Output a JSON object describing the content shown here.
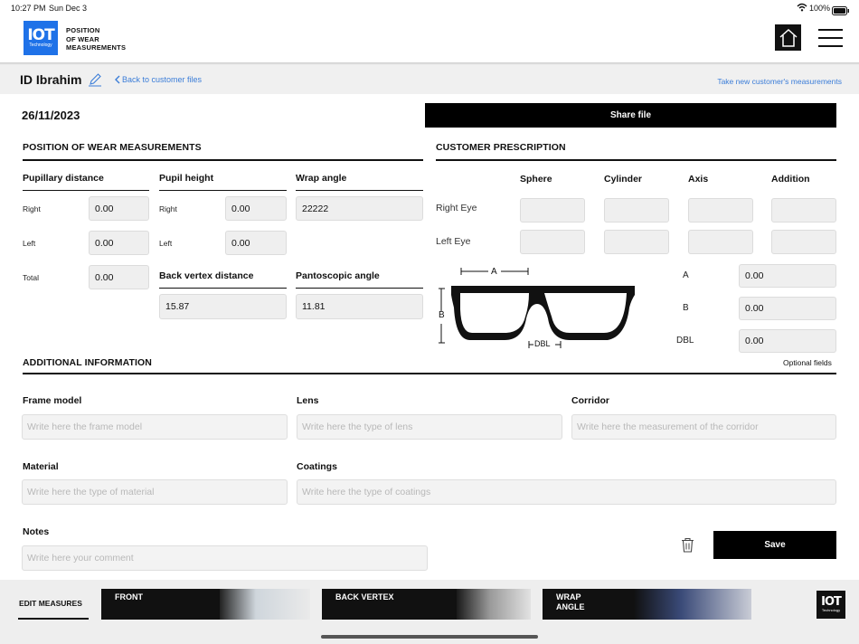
{
  "status_bar": {
    "time": "10:27 PM",
    "date": "Sun Dec 3",
    "battery": "100%"
  },
  "header": {
    "logo_text": "IOT",
    "logo_sub": "Technology",
    "title_line1": "POSITION",
    "title_line2": "OF WEAR",
    "title_line3": "MEASUREMENTS"
  },
  "subheader": {
    "customer": "ID Ibrahim",
    "back_link": "Back to customer files",
    "new_measure_link": "Take new customer's measurements"
  },
  "date": "26/11/2023",
  "share_button": "Share file",
  "position_of_wear": {
    "title": "POSITION OF WEAR MEASUREMENTS",
    "pupillary_distance": {
      "label": "Pupillary distance",
      "right_label": "Right",
      "right": "0.00",
      "left_label": "Left",
      "left": "0.00",
      "total_label": "Total",
      "total": "0.00"
    },
    "pupil_height": {
      "label": "Pupil height",
      "right_label": "Right",
      "right": "0.00",
      "left_label": "Left",
      "left": "0.00"
    },
    "wrap_angle": {
      "label": "Wrap angle",
      "value": "22222"
    },
    "back_vertex": {
      "label": "Back vertex distance",
      "value": "15.87"
    },
    "pantoscopic": {
      "label": "Pantoscopic angle",
      "value": "11.81"
    }
  },
  "prescription": {
    "title": "CUSTOMER PRESCRIPTION",
    "columns": [
      "Sphere",
      "Cylinder",
      "Axis",
      "Addition"
    ],
    "rows": [
      {
        "label": "Right Eye",
        "values": [
          "",
          "",
          "",
          ""
        ]
      },
      {
        "label": "Left Eye",
        "values": [
          "",
          "",
          "",
          ""
        ]
      }
    ],
    "frame": {
      "a_label": "A",
      "a_value": "0.00",
      "b_label": "B",
      "b_value": "0.00",
      "dbl_label": "DBL",
      "dbl_value": "0.00"
    }
  },
  "additional": {
    "title": "ADDITIONAL INFORMATION",
    "optional": "Optional fields",
    "frame_model": {
      "label": "Frame model",
      "placeholder": "Write here the frame model"
    },
    "lens": {
      "label": "Lens",
      "placeholder": "Write here the type of lens"
    },
    "corridor": {
      "label": "Corridor",
      "placeholder": "Write here the measurement of the corridor"
    },
    "material": {
      "label": "Material",
      "placeholder": "Write here the type of material"
    },
    "coatings": {
      "label": "Coatings",
      "placeholder": "Write here the type of coatings"
    },
    "notes": {
      "label": "Notes",
      "placeholder": "Write here your comment"
    },
    "save": "Save"
  },
  "bottom": {
    "edit_measures": "EDIT MEASURES",
    "thumbs": [
      {
        "label": "FRONT"
      },
      {
        "label": "BACK VERTEX"
      },
      {
        "label": "WRAP ANGLE"
      }
    ]
  }
}
